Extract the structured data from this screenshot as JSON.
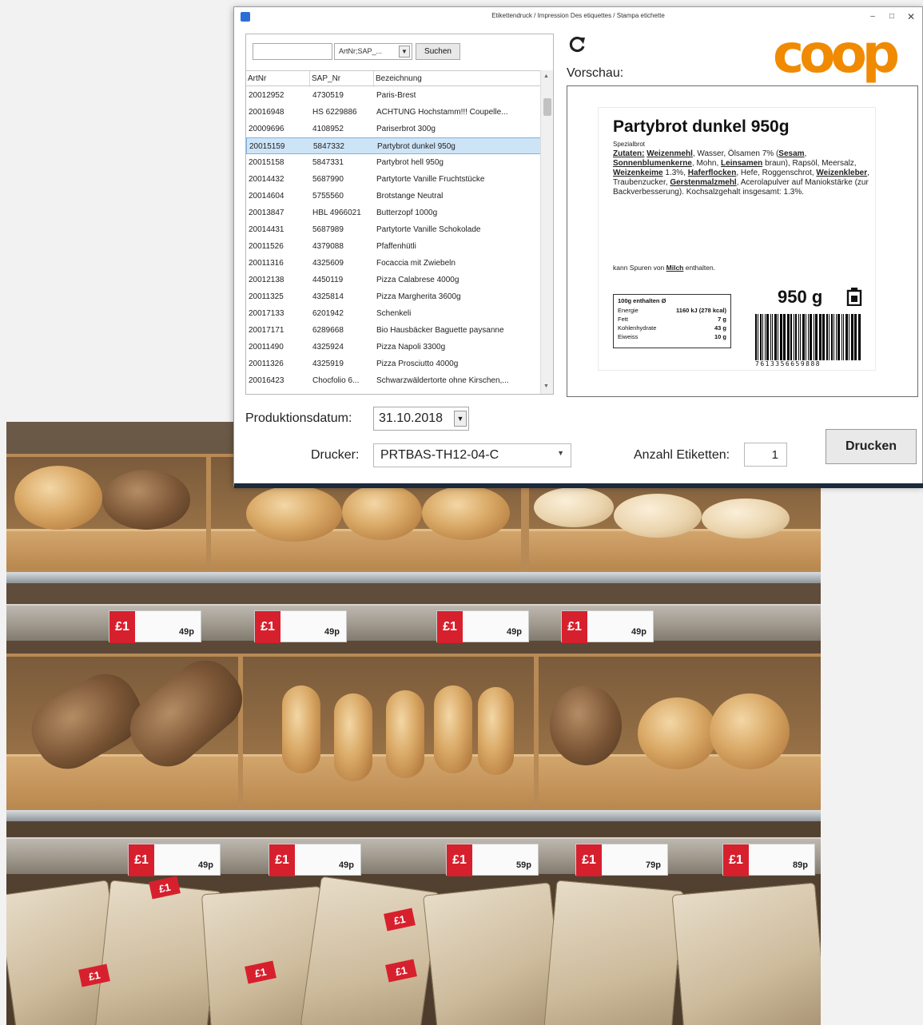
{
  "window": {
    "title": "Etikettendruck / Impression Des etiquettes / Stampa etichette",
    "minimize": "–",
    "maximize": "□",
    "close": "✕"
  },
  "search": {
    "value": "",
    "filter_value": "ArtNr;SAP_...",
    "button_label": "Suchen"
  },
  "table": {
    "columns": [
      "ArtNr",
      "SAP_Nr",
      "Bezeichnung"
    ],
    "rows": [
      [
        "20012952",
        "4730519",
        "Paris-Brest"
      ],
      [
        "20016948",
        "HS 6229886",
        "ACHTUNG Hochstamm!!! Coupelle..."
      ],
      [
        "20009696",
        "4108952",
        "Pariserbrot 300g"
      ],
      [
        "20015159",
        "5847332",
        "Partybrot dunkel 950g"
      ],
      [
        "20015158",
        "5847331",
        "Partybrot hell 950g"
      ],
      [
        "20014432",
        "5687990",
        "Partytorte Vanille Fruchtstücke"
      ],
      [
        "20014604",
        "5755560",
        "Brotstange Neutral"
      ],
      [
        "20013847",
        "HBL 4966021",
        "Butterzopf 1000g"
      ],
      [
        "20014431",
        "5687989",
        "Partytorte Vanille Schokolade"
      ],
      [
        "20011526",
        "4379088",
        "Pfaffenhütli"
      ],
      [
        "20011316",
        "4325609",
        "Focaccia mit Zwiebeln"
      ],
      [
        "20012138",
        "4450119",
        "Pizza Calabrese 4000g"
      ],
      [
        "20011325",
        "4325814",
        "Pizza Margherita 3600g"
      ],
      [
        "20017133",
        "6201942",
        "Schenkeli"
      ],
      [
        "20017171",
        "6289668",
        "Bio Hausbäcker Baguette paysanne"
      ],
      [
        "20011490",
        "4325924",
        "Pizza Napoli 3300g"
      ],
      [
        "20011326",
        "4325919",
        "Pizza Prosciutto 4000g"
      ],
      [
        "20016423",
        "Chocfolio 6...",
        "Schwarzwäldertorte ohne Kirschen,..."
      ]
    ],
    "selected_index": 3
  },
  "preview": {
    "label": "Vorschau:",
    "brand": "coop",
    "product_title": "Partybrot dunkel 950g",
    "subtitle": "Spezialbrot",
    "ingredients_prefix": "Zutaten:",
    "ingredients": [
      {
        "t": "Weizenmehl",
        "b": true
      },
      {
        "t": ", Wasser, Ölsamen 7% (",
        "b": false
      },
      {
        "t": "Sesam",
        "b": true
      },
      {
        "t": ", ",
        "b": false
      },
      {
        "t": "Sonnenblumenkerne",
        "b": true
      },
      {
        "t": ", Mohn, ",
        "b": false
      },
      {
        "t": "Leinsamen",
        "b": true
      },
      {
        "t": " braun), Rapsöl, Meersalz, ",
        "b": false
      },
      {
        "t": "Weizenkeime",
        "b": true
      },
      {
        "t": " 1.3%, ",
        "b": false
      },
      {
        "t": "Haferflocken",
        "b": true
      },
      {
        "t": ", Hefe, Roggenschrot, ",
        "b": false
      },
      {
        "t": "Weizenkleber",
        "b": true
      },
      {
        "t": ", Traubenzucker, ",
        "b": false
      },
      {
        "t": "Gerstenmalzmehl",
        "b": true
      },
      {
        "t": ", Acerolapulver auf Maniokstärke (zur Backverbesserung). Kochsalzgehalt insgesamt: 1.3%.",
        "b": false
      }
    ],
    "allergen_prefix": "kann Spuren von ",
    "allergen": "Milch",
    "allergen_suffix": " enthalten.",
    "nutrition_title": "100g enthalten Ø",
    "nutrition": [
      {
        "name": "Energie",
        "value": "1160 kJ (278 kcal)"
      },
      {
        "name": "Fett",
        "value": "7 g"
      },
      {
        "name": "Kohlenhydrate",
        "value": "43 g"
      },
      {
        "name": "Eiweiss",
        "value": "10 g"
      }
    ],
    "weight": "950 g",
    "barcode_digits": "7613356659888"
  },
  "form": {
    "prod_date_label": "Produktionsdatum:",
    "prod_date_value": "31.10.2018",
    "printer_label": "Drucker:",
    "printer_value": "PRTBAS-TH12-04-C",
    "count_label": "Anzahl Etiketten:",
    "count_value": "1",
    "print_button": "Drucken"
  },
  "photo": {
    "shelf_badge": "£1",
    "shelf_prices": [
      "49p",
      "49p",
      "49p",
      "49p",
      "49p",
      "49p",
      "59p",
      "79p",
      "89p"
    ]
  },
  "colors": {
    "brand": "#f08a00",
    "selection": "#cde4f7",
    "price_badge": "#d7202d"
  }
}
